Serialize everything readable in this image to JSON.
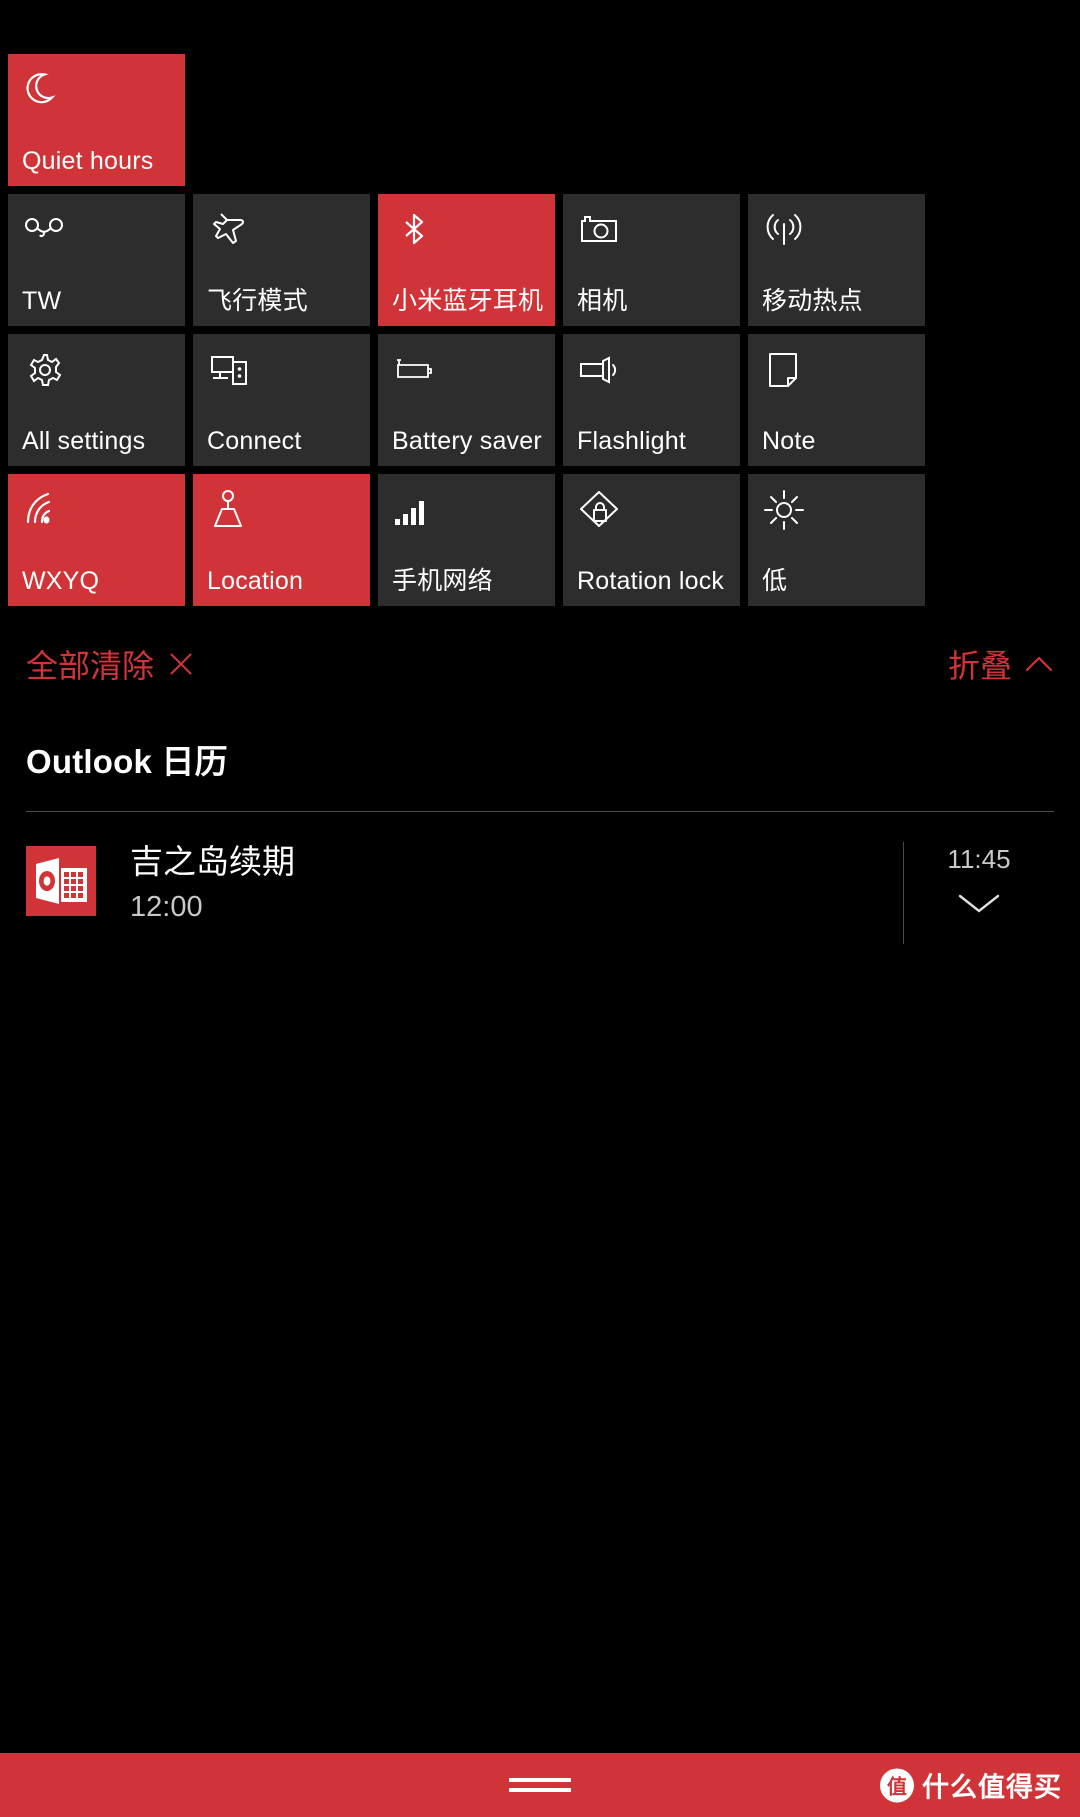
{
  "accent_color": "#d13438",
  "tile_off_color": "#2d2d2d",
  "background_color": "#000000",
  "quick_actions": {
    "rows": [
      [
        {
          "label": "Quiet hours",
          "icon": "moon-icon",
          "state": "on"
        },
        {
          "label": "",
          "icon": "",
          "state": "empty"
        },
        {
          "label": "",
          "icon": "",
          "state": "empty"
        },
        {
          "label": "",
          "icon": "",
          "state": "empty"
        },
        {
          "label": "",
          "icon": "",
          "state": "empty"
        }
      ],
      [
        {
          "label": "TW",
          "icon": "vpn-icon",
          "state": "off"
        },
        {
          "label": "飞行模式",
          "icon": "airplane-icon",
          "state": "off"
        },
        {
          "label": "小米蓝牙耳机",
          "icon": "bluetooth-icon",
          "state": "on"
        },
        {
          "label": "相机",
          "icon": "camera-icon",
          "state": "off"
        },
        {
          "label": "移动热点",
          "icon": "hotspot-icon",
          "state": "off"
        }
      ],
      [
        {
          "label": "All settings",
          "icon": "gear-icon",
          "state": "off"
        },
        {
          "label": "Connect",
          "icon": "connect-icon",
          "state": "off"
        },
        {
          "label": "Battery saver",
          "icon": "battery-saver-icon",
          "state": "off"
        },
        {
          "label": "Flashlight",
          "icon": "flashlight-icon",
          "state": "off"
        },
        {
          "label": "Note",
          "icon": "note-icon",
          "state": "off"
        }
      ],
      [
        {
          "label": "WXYQ",
          "icon": "wifi-icon",
          "state": "on"
        },
        {
          "label": "Location",
          "icon": "location-icon",
          "state": "on"
        },
        {
          "label": "手机网络",
          "icon": "cellular-signal-icon",
          "state": "off"
        },
        {
          "label": "Rotation lock",
          "icon": "rotation-lock-icon",
          "state": "off"
        },
        {
          "label": "低",
          "icon": "brightness-icon",
          "state": "off"
        }
      ]
    ]
  },
  "action_links": {
    "clear_all_label": "全部清除",
    "clear_all_glyph": "×",
    "collapse_label": "折叠",
    "collapse_glyph": "^"
  },
  "notification_group": {
    "header": "Outlook 日历",
    "items": [
      {
        "app_icon": "outlook-calendar-icon",
        "title": "吉之岛续期",
        "subtitle": "12:00",
        "time": "11:45",
        "expand_glyph": "chevron-down-icon"
      }
    ]
  },
  "bottom_bar": {
    "nav_handle": "nav-handle",
    "watermark_badge": "值",
    "watermark_text": "什么值得买"
  }
}
